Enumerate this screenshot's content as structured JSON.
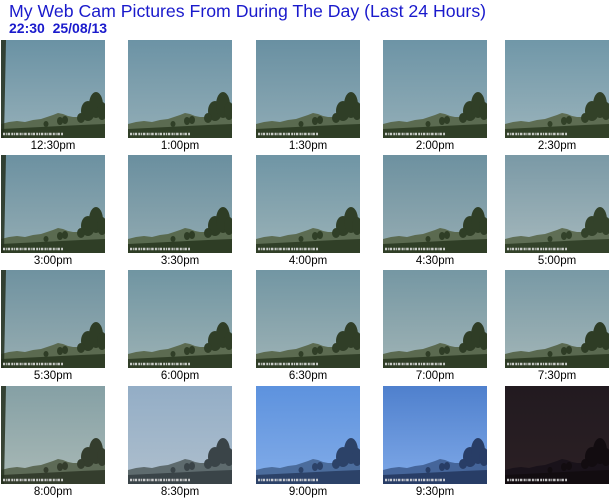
{
  "page": {
    "title": "My Web Cam Pictures From During The Day (Last 24 Hours)",
    "timestamp": "22:30  25/08/13"
  },
  "colors": {
    "heading": "#1a1acc",
    "label": "#000000",
    "background": "#ffffff"
  },
  "thumbnails": [
    {
      "time": "12:30pm",
      "sky_top": "#6a92a4",
      "sky_bottom": "#95afb8",
      "land": "#5a6a50",
      "ground": "#2f3e26"
    },
    {
      "time": "1:00pm",
      "sky_top": "#6c93a5",
      "sky_bottom": "#92adb6",
      "land": "#5b6b51",
      "ground": "#303f27"
    },
    {
      "time": "1:30pm",
      "sky_top": "#6990a2",
      "sky_bottom": "#8fabb5",
      "land": "#5a6a50",
      "ground": "#2f3e26"
    },
    {
      "time": "2:00pm",
      "sky_top": "#6d94a6",
      "sky_bottom": "#93aeb7",
      "land": "#5b6b51",
      "ground": "#303f27"
    },
    {
      "time": "2:30pm",
      "sky_top": "#7097a8",
      "sky_bottom": "#9ab3bb",
      "land": "#5e6d53",
      "ground": "#324128"
    },
    {
      "time": "3:00pm",
      "sky_top": "#6c91a1",
      "sky_bottom": "#93acb3",
      "land": "#5a6a50",
      "ground": "#2f3e26"
    },
    {
      "time": "3:30pm",
      "sky_top": "#6a8f9f",
      "sky_bottom": "#91aab1",
      "land": "#596a4f",
      "ground": "#2e3d25"
    },
    {
      "time": "4:00pm",
      "sky_top": "#6f95a5",
      "sky_bottom": "#9ab2b7",
      "land": "#5c6c52",
      "ground": "#303f27"
    },
    {
      "time": "4:30pm",
      "sky_top": "#6d91a0",
      "sky_bottom": "#95acb2",
      "land": "#5b6a50",
      "ground": "#2f3e26"
    },
    {
      "time": "5:00pm",
      "sky_top": "#7a99a6",
      "sky_bottom": "#a5b8bc",
      "land": "#5f6e55",
      "ground": "#33422a"
    },
    {
      "time": "5:30pm",
      "sky_top": "#6f92a0",
      "sky_bottom": "#97adb1",
      "land": "#5b6a50",
      "ground": "#2f3d26"
    },
    {
      "time": "6:00pm",
      "sky_top": "#7095a2",
      "sky_bottom": "#9bb1b4",
      "land": "#5c6b51",
      "ground": "#303e27"
    },
    {
      "time": "6:30pm",
      "sky_top": "#7296a3",
      "sky_bottom": "#9db2b5",
      "land": "#5c6b51",
      "ground": "#303e27"
    },
    {
      "time": "7:00pm",
      "sky_top": "#7597a3",
      "sky_bottom": "#9fb3b5",
      "land": "#5b6a50",
      "ground": "#2f3d26"
    },
    {
      "time": "7:30pm",
      "sky_top": "#7899a5",
      "sky_bottom": "#a2b5b7",
      "land": "#5a6950",
      "ground": "#2e3c25"
    },
    {
      "time": "8:00pm",
      "sky_top": "#85a0a5",
      "sky_bottom": "#a9b9b6",
      "land": "#5d6a56",
      "ground": "#343d2d"
    },
    {
      "time": "8:30pm",
      "sky_top": "#93adc6",
      "sky_bottom": "#aebfcd",
      "land": "#5e6b6e",
      "ground": "#3a4448"
    },
    {
      "time": "9:00pm",
      "sky_top": "#5d92de",
      "sky_bottom": "#82ace8",
      "land": "#4b6c9c",
      "ground": "#2c4268"
    },
    {
      "time": "9:30pm",
      "sky_top": "#4f80cd",
      "sky_bottom": "#7fa9e8",
      "land": "#45659a",
      "ground": "#283d66"
    },
    {
      "sky_top": "#221a20",
      "sky_bottom": "#2b2024",
      "land": "#19121a",
      "ground": "#120c10"
    }
  ]
}
